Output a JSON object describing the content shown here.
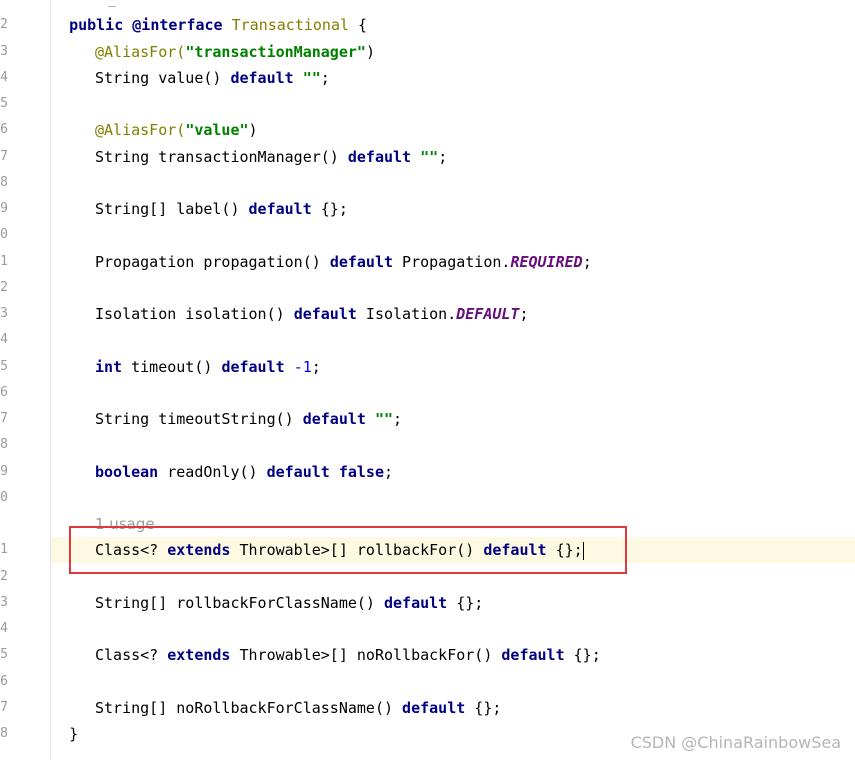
{
  "gutter": {
    "line_numbers": [
      "2",
      "3",
      "4",
      "5",
      "6",
      "7",
      "8",
      "9",
      "0",
      "1",
      "2",
      "3",
      "4",
      "5",
      "6",
      "7",
      "8",
      "9",
      "0",
      "1",
      "2",
      "3",
      "4",
      "5",
      "6",
      "7",
      "8"
    ]
  },
  "code": {
    "decl_kw1": "public",
    "decl_kw2": "@interface",
    "decl_name": "Transactional",
    "decl_brace": " {",
    "l3_ann": "@AliasFor(",
    "l3_str": "\"transactionManager\"",
    "l3_end": ")",
    "l4_pre": "String value() ",
    "l4_kw": "default",
    "l4_str": "\"\"",
    "l4_end": ";",
    "l6_ann": "@AliasFor(",
    "l6_str": "\"value\"",
    "l6_end": ")",
    "l7_pre": "String transactionManager() ",
    "l7_kw": "default",
    "l7_str": "\"\"",
    "l7_end": ";",
    "l9_pre": "String[] label() ",
    "l9_kw": "default",
    "l9_end": " {};",
    "l11_pre": "Propagation propagation() ",
    "l11_kw": "default",
    "l11_mid": " Propagation.",
    "l11_const": "REQUIRED",
    "l11_end": ";",
    "l13_pre": "Isolation isolation() ",
    "l13_kw": "default",
    "l13_mid": " Isolation.",
    "l13_const": "DEFAULT",
    "l13_end": ";",
    "l15_kw1": "int",
    "l15_mid": " timeout() ",
    "l15_kw2": "default",
    "l15_num": "-1",
    "l15_end": ";",
    "l17_pre": "String timeoutString() ",
    "l17_kw": "default",
    "l17_str": "\"\"",
    "l17_end": ";",
    "l19_kw1": "boolean",
    "l19_mid": " readOnly() ",
    "l19_kw2": "default",
    "l19_kw3": "false",
    "l19_end": ";",
    "usage_hint": "1 usage",
    "l21_pre": "Class<? ",
    "l21_kw": "extends",
    "l21_mid": " Throwable>[] rollbackFor() ",
    "l21_kw2": "default",
    "l21_end": " {};",
    "l23_pre": "String[] rollbackForClassName() ",
    "l23_kw": "default",
    "l23_end": " {};",
    "l25_pre": "Class<? ",
    "l25_kw": "extends",
    "l25_mid": " Throwable>[] noRollbackFor() ",
    "l25_kw2": "default",
    "l25_end": " {};",
    "l27_pre": "String[] noRollbackForClassName() ",
    "l27_kw": "default",
    "l27_end": " {};",
    "closing": "}"
  },
  "watermark": "CSDN @ChinaRainbowSea",
  "colors": {
    "keyword": "#000080",
    "annotation": "#808000",
    "string": "#008000",
    "constant": "#660e7a",
    "highlight_box": "#e0363d",
    "current_line": "#fdf9e3"
  }
}
